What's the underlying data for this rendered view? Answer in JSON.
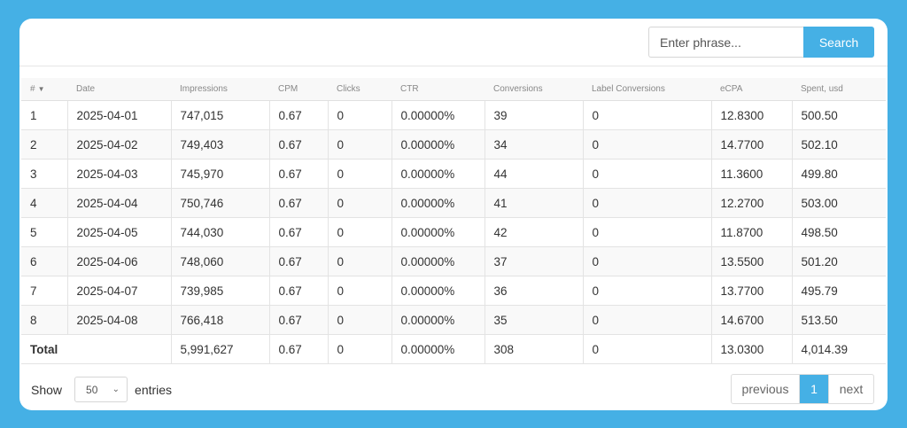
{
  "search": {
    "placeholder": "Enter phrase...",
    "button_label": "Search"
  },
  "table": {
    "headers": [
      "#",
      "Date",
      "Impressions",
      "CPM",
      "Clicks",
      "CTR",
      "Conversions",
      "Label Conversions",
      "eCPA",
      "Spent, usd"
    ],
    "sort_indicator": "▼",
    "rows": [
      [
        "1",
        "2025-04-01",
        "747,015",
        "0.67",
        "0",
        "0.00000%",
        "39",
        "0",
        "12.8300",
        "500.50"
      ],
      [
        "2",
        "2025-04-02",
        "749,403",
        "0.67",
        "0",
        "0.00000%",
        "34",
        "0",
        "14.7700",
        "502.10"
      ],
      [
        "3",
        "2025-04-03",
        "745,970",
        "0.67",
        "0",
        "0.00000%",
        "44",
        "0",
        "11.3600",
        "499.80"
      ],
      [
        "4",
        "2025-04-04",
        "750,746",
        "0.67",
        "0",
        "0.00000%",
        "41",
        "0",
        "12.2700",
        "503.00"
      ],
      [
        "5",
        "2025-04-05",
        "744,030",
        "0.67",
        "0",
        "0.00000%",
        "42",
        "0",
        "11.8700",
        "498.50"
      ],
      [
        "6",
        "2025-04-06",
        "748,060",
        "0.67",
        "0",
        "0.00000%",
        "37",
        "0",
        "13.5500",
        "501.20"
      ],
      [
        "7",
        "2025-04-07",
        "739,985",
        "0.67",
        "0",
        "0.00000%",
        "36",
        "0",
        "13.7700",
        "495.79"
      ],
      [
        "8",
        "2025-04-08",
        "766,418",
        "0.67",
        "0",
        "0.00000%",
        "35",
        "0",
        "14.6700",
        "513.50"
      ]
    ],
    "total": {
      "label": "Total",
      "values": [
        "5,991,627",
        "0.67",
        "0",
        "0.00000%",
        "308",
        "0",
        "13.0300",
        "4,014.39"
      ]
    }
  },
  "footer": {
    "show_label": "Show",
    "page_size": "50",
    "entries_label": "entries",
    "pagination": {
      "previous": "previous",
      "current": "1",
      "next": "next"
    }
  },
  "colors": {
    "accent": "#45b0e5",
    "background": "#45b0e5",
    "card": "#ffffff"
  }
}
